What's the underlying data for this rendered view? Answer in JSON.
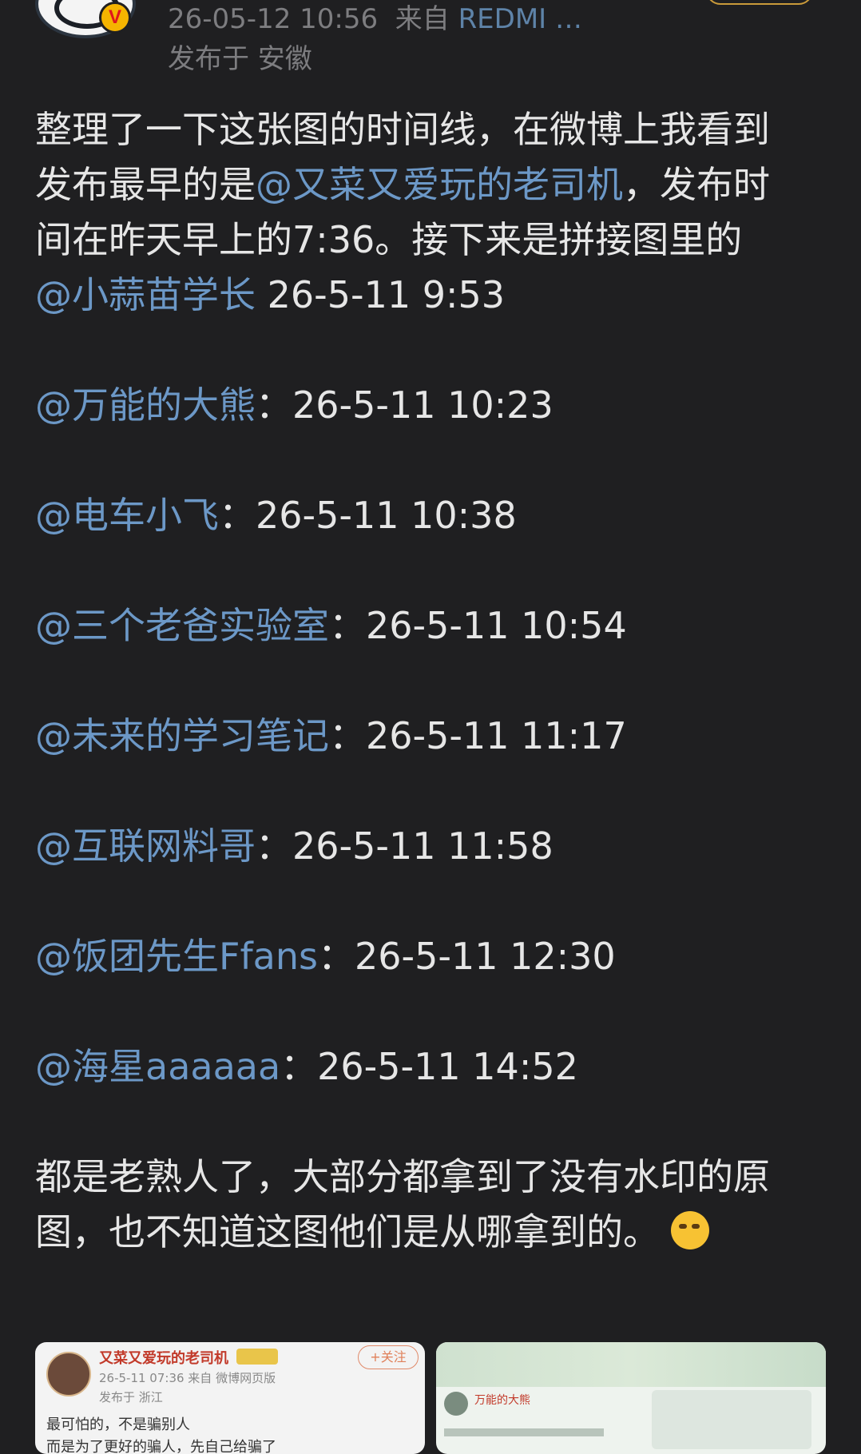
{
  "header": {
    "timestamp": "26-05-12 10:56",
    "source_prefix": "来自",
    "source": "REDMI …",
    "location": "发布于 安徽",
    "verified_badge": "V"
  },
  "post": {
    "intro": [
      {
        "text": "整理了一下这张图的时间线，在微博上我看到发布最早的是",
        "mention": false
      },
      {
        "text": "@又菜又爱玩的老司机",
        "mention": true
      },
      {
        "text": "，发布时间在昨天早上的7:36。接下来是拼接图里的",
        "mention": false
      }
    ],
    "timeline": [
      {
        "user": "@小蒜苗学长",
        "sep": " ",
        "time": "26-5-11 9:53"
      },
      {
        "user": "@万能的大熊",
        "sep": "：",
        "time": "26-5-11 10:23"
      },
      {
        "user": "@电车小飞",
        "sep": "：",
        "time": "26-5-11 10:38"
      },
      {
        "user": "@三个老爸实验室",
        "sep": "：",
        "time": "26-5-11 10:54"
      },
      {
        "user": "@未来的学习笔记",
        "sep": "：",
        "time": "26-5-11 11:17"
      },
      {
        "user": "@互联网料哥",
        "sep": "：",
        "time": "26-5-11 11:58"
      },
      {
        "user": "@饭团先生Ffans",
        "sep": "：",
        "time": "26-5-11 12:30"
      },
      {
        "user": "@海星aaaaaa",
        "sep": "：",
        "time": "26-5-11 14:52"
      }
    ],
    "closing": "都是老熟人了，大部分都拿到了没有水印的原图，也不知道这图他们是从哪拿到的。",
    "closing_emoji": "thinking-emoji"
  },
  "thumbnails": [
    {
      "author": "又菜又爱玩的老司机",
      "follow_label": "+关注",
      "meta": "26-5-11 07:36  来自 微博网页版",
      "location": "发布于 浙江",
      "text_line1": "最可怕的，不是骗别人",
      "text_line2": "而是为了更好的骗人，先自己给骗了"
    },
    {
      "author": "万能的大熊"
    }
  ],
  "colors": {
    "background": "#1f1f21",
    "text": "#e6e6e6",
    "mention": "#6c98c7",
    "meta": "#7d7d80"
  }
}
